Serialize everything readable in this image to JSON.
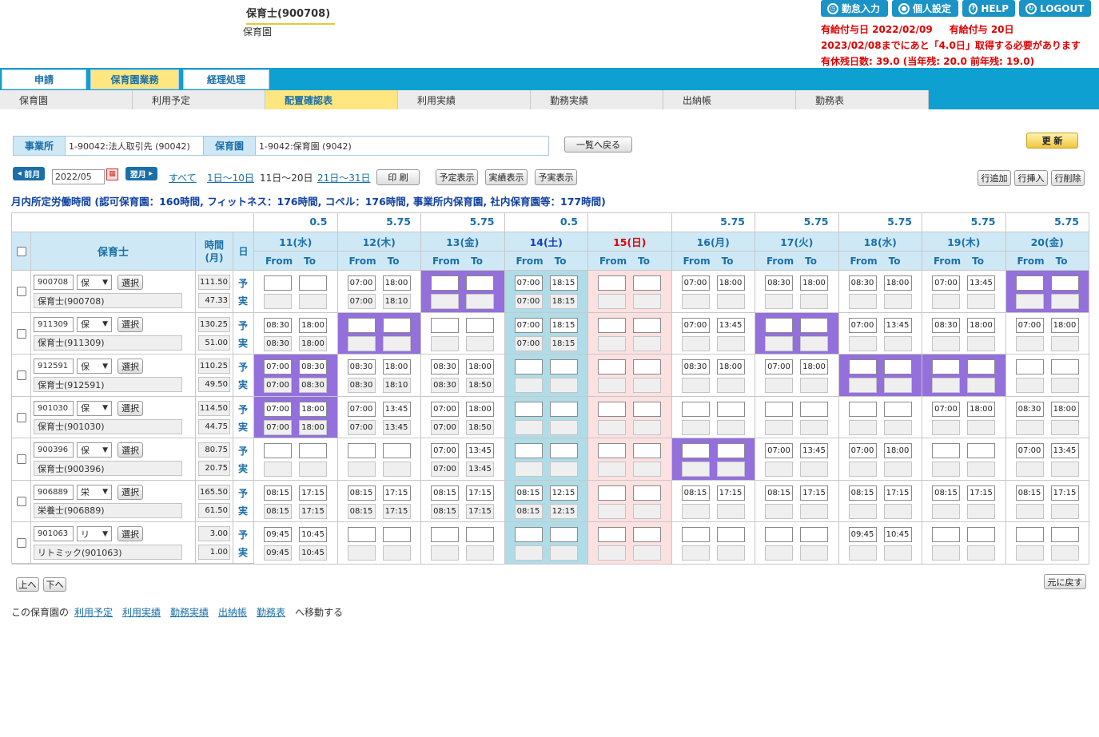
{
  "header": {
    "user_title": "保育士(900708)",
    "user_sub": "保育園",
    "buttons": {
      "attendance": "勤怠入力",
      "personal": "個人設定",
      "help": "HELP",
      "logout": "LOGOUT"
    },
    "alerts": {
      "line1a": "有給付与日 2022/02/09",
      "line1b": "有給付与 20日",
      "line2": "2023/02/08までにあと「4.0日」取得する必要があります",
      "line3": "有休残日数: 39.0 (当年残: 20.0 前年残: 19.0)"
    }
  },
  "nav": {
    "main_tabs": [
      "申請",
      "保育園業務",
      "経理処理"
    ],
    "main_active": 1,
    "sub_tabs": [
      "保育園",
      "利用予定",
      "配置確認表",
      "利用実績",
      "勤務実績",
      "出納帳",
      "勤務表"
    ],
    "sub_active": 2
  },
  "office": {
    "label_office": "事業所",
    "office_value": "1-90042:法人取引先 (90042)",
    "label_nursery": "保育園",
    "nursery_value": "1-9042:保育園 (9042)",
    "back_button": "一覧へ戻る",
    "update_button": "更 新"
  },
  "controls": {
    "prev_month": "前月",
    "month": "2022/05",
    "next_month": "翌月",
    "filter_all": "すべて",
    "filter_1_10": "1日～10日",
    "filter_11_20": "11日～20日",
    "filter_21_31": "21日～31日",
    "print": "印 刷",
    "show_plan": "予定表示",
    "show_actual": "実績表示",
    "show_both": "予実表示",
    "add_row": "行追加",
    "insert_row": "行挿入",
    "delete_row": "行削除"
  },
  "notice": "月内所定労働時間 (認可保育園：160時間, フィットネス：176時間, コペル：176時間, 事業所内保育園, 社内保育園等：177時間)",
  "table": {
    "col_staff": "保育士",
    "col_hours": "時間\n(月)",
    "col_day": "日",
    "from_label": "From",
    "to_label": "To",
    "plan_label": "予",
    "actual_label": "実",
    "select_label": "選択",
    "days": [
      {
        "label": "11(水)",
        "total": "0.5",
        "kind": "weekday"
      },
      {
        "label": "12(木)",
        "total": "5.75",
        "kind": "weekday"
      },
      {
        "label": "13(金)",
        "total": "5.75",
        "kind": "weekday"
      },
      {
        "label": "14(土)",
        "total": "0.5",
        "kind": "sat"
      },
      {
        "label": "15(日)",
        "total": "",
        "kind": "sun"
      },
      {
        "label": "16(月)",
        "total": "5.75",
        "kind": "weekday"
      },
      {
        "label": "17(火)",
        "total": "5.75",
        "kind": "weekday"
      },
      {
        "label": "18(水)",
        "total": "5.75",
        "kind": "weekday"
      },
      {
        "label": "19(木)",
        "total": "5.75",
        "kind": "weekday"
      },
      {
        "label": "20(金)",
        "total": "5.75",
        "kind": "weekday"
      }
    ],
    "rows": [
      {
        "id": "900708",
        "type": "保",
        "name": "保育士(900708)",
        "h1": "111.50",
        "h2": "47.33",
        "cells": [
          [
            "",
            "",
            "",
            ""
          ],
          [
            "07:00",
            "18:00",
            "07:00",
            "18:10"
          ],
          [
            "",
            "",
            "",
            ""
          ],
          [
            "07:00",
            "18:15",
            "07:00",
            "18:15"
          ],
          [
            "",
            "",
            "",
            ""
          ],
          [
            "07:00",
            "18:00",
            "",
            ""
          ],
          [
            "08:30",
            "18:00",
            "",
            ""
          ],
          [
            "08:30",
            "18:00",
            "",
            ""
          ],
          [
            "07:00",
            "13:45",
            "",
            ""
          ],
          [
            "",
            "",
            "",
            ""
          ]
        ],
        "purple": [
          2,
          9
        ]
      },
      {
        "id": "911309",
        "type": "保",
        "name": "保育士(911309)",
        "h1": "130.25",
        "h2": "51.00",
        "cells": [
          [
            "08:30",
            "18:00",
            "08:30",
            "18:00"
          ],
          [
            "",
            "",
            "",
            ""
          ],
          [
            "",
            "",
            "",
            ""
          ],
          [
            "07:00",
            "18:15",
            "07:00",
            "18:15"
          ],
          [
            "",
            "",
            "",
            ""
          ],
          [
            "07:00",
            "13:45",
            "",
            ""
          ],
          [
            "",
            "",
            "",
            ""
          ],
          [
            "07:00",
            "13:45",
            "",
            ""
          ],
          [
            "08:30",
            "18:00",
            "",
            ""
          ],
          [
            "07:00",
            "18:00",
            "",
            ""
          ]
        ],
        "purple": [
          1,
          6
        ]
      },
      {
        "id": "912591",
        "type": "保",
        "name": "保育士(912591)",
        "h1": "110.25",
        "h2": "49.50",
        "cells": [
          [
            "07:00",
            "08:30",
            "07:00",
            "08:30"
          ],
          [
            "08:30",
            "18:00",
            "08:30",
            "18:10"
          ],
          [
            "08:30",
            "18:00",
            "08:30",
            "18:50"
          ],
          [
            "",
            "",
            "",
            ""
          ],
          [
            "",
            "",
            "",
            ""
          ],
          [
            "08:30",
            "18:00",
            "",
            ""
          ],
          [
            "07:00",
            "18:00",
            "",
            ""
          ],
          [
            "",
            "",
            "",
            ""
          ],
          [
            "",
            "",
            "",
            ""
          ],
          [
            "",
            "",
            "",
            ""
          ]
        ],
        "purple": [
          0,
          7,
          8
        ]
      },
      {
        "id": "901030",
        "type": "保",
        "name": "保育士(901030)",
        "h1": "114.50",
        "h2": "44.75",
        "cells": [
          [
            "07:00",
            "18:00",
            "07:00",
            "18:00"
          ],
          [
            "07:00",
            "13:45",
            "07:00",
            "13:45"
          ],
          [
            "07:00",
            "18:00",
            "07:00",
            "18:50"
          ],
          [
            "",
            "",
            "",
            ""
          ],
          [
            "",
            "",
            "",
            ""
          ],
          [
            "",
            "",
            "",
            ""
          ],
          [
            "",
            "",
            "",
            ""
          ],
          [
            "",
            "",
            "",
            ""
          ],
          [
            "07:00",
            "18:00",
            "",
            ""
          ],
          [
            "08:30",
            "18:00",
            "",
            ""
          ]
        ],
        "purple": [
          0
        ]
      },
      {
        "id": "900396",
        "type": "保",
        "name": "保育士(900396)",
        "h1": "80.75",
        "h2": "20.75",
        "cells": [
          [
            "",
            "",
            "",
            ""
          ],
          [
            "",
            "",
            "",
            ""
          ],
          [
            "07:00",
            "13:45",
            "07:00",
            "13:45"
          ],
          [
            "",
            "",
            "",
            ""
          ],
          [
            "",
            "",
            "",
            ""
          ],
          [
            "",
            "",
            "",
            ""
          ],
          [
            "07:00",
            "13:45",
            "",
            ""
          ],
          [
            "07:00",
            "18:00",
            "",
            ""
          ],
          [
            "",
            "",
            "",
            ""
          ],
          [
            "07:00",
            "13:45",
            "",
            ""
          ]
        ],
        "purple": [
          5
        ]
      },
      {
        "id": "906889",
        "type": "栄",
        "name": "栄養士(906889)",
        "h1": "165.50",
        "h2": "61.50",
        "cells": [
          [
            "08:15",
            "17:15",
            "08:15",
            "17:15"
          ],
          [
            "08:15",
            "17:15",
            "08:15",
            "17:15"
          ],
          [
            "08:15",
            "17:15",
            "08:15",
            "17:15"
          ],
          [
            "08:15",
            "12:15",
            "08:15",
            "12:15"
          ],
          [
            "",
            "",
            "",
            ""
          ],
          [
            "08:15",
            "17:15",
            "",
            ""
          ],
          [
            "08:15",
            "17:15",
            "",
            ""
          ],
          [
            "08:15",
            "17:15",
            "",
            ""
          ],
          [
            "08:15",
            "17:15",
            "",
            ""
          ],
          [
            "08:15",
            "17:15",
            "",
            ""
          ]
        ],
        "purple": []
      },
      {
        "id": "901063",
        "type": "リ",
        "name": "リトミック(901063)",
        "h1": "3.00",
        "h2": "1.00",
        "cells": [
          [
            "09:45",
            "10:45",
            "09:45",
            "10:45"
          ],
          [
            "",
            "",
            "",
            ""
          ],
          [
            "",
            "",
            "",
            ""
          ],
          [
            "",
            "",
            "",
            ""
          ],
          [
            "",
            "",
            "",
            ""
          ],
          [
            "",
            "",
            "",
            ""
          ],
          [
            "",
            "",
            "",
            ""
          ],
          [
            "09:45",
            "10:45",
            "",
            ""
          ],
          [
            "",
            "",
            "",
            ""
          ],
          [
            "",
            "",
            "",
            ""
          ]
        ],
        "purple": []
      }
    ]
  },
  "footer": {
    "up": "上へ",
    "down": "下へ",
    "restore": "元に戻す",
    "prefix": "この保育園の",
    "links": [
      "利用予定",
      "利用実績",
      "勤務実績",
      "出納帳",
      "勤務表"
    ],
    "suffix": "へ移動する"
  },
  "colors": {
    "accent": "#0ea0d0",
    "purple": "#9370db",
    "saturday": "#b0dce8",
    "sunday": "#fde0e0",
    "alert_red": "#e00000"
  }
}
